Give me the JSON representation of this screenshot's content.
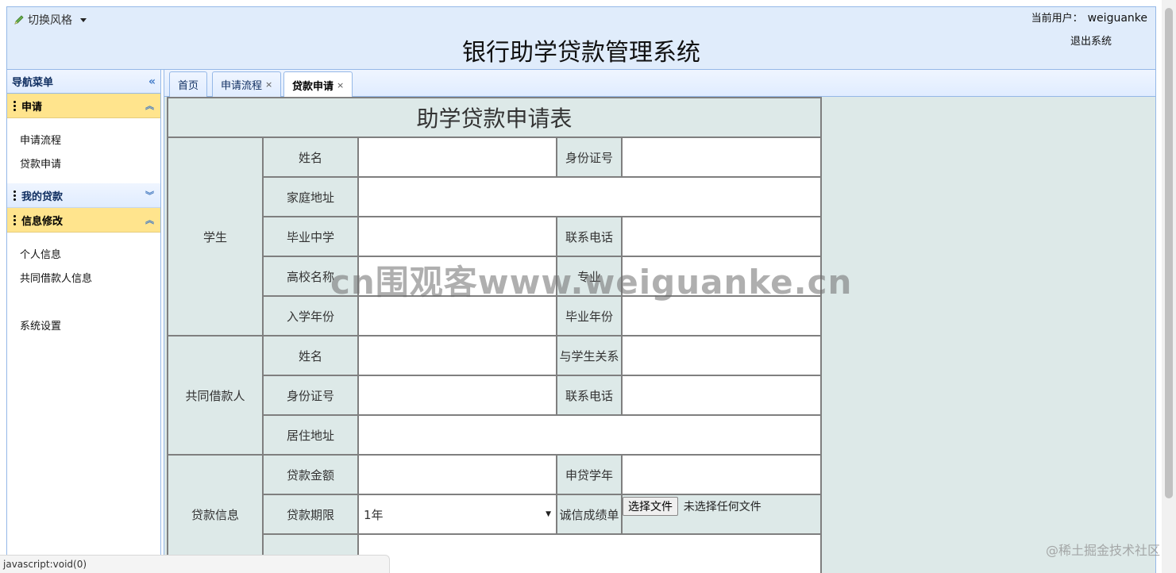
{
  "header": {
    "style_switch_label": "切换风格",
    "app_title": "银行助学贷款管理系统",
    "current_user_label": "当前用户：",
    "current_user_name": "weiguanke",
    "logout_label": "退出系统"
  },
  "sidebar": {
    "nav_title": "导航菜单",
    "sections": [
      {
        "title": "申请",
        "state": "open",
        "items": [
          "申请流程",
          "贷款申请"
        ]
      },
      {
        "title": "我的贷款",
        "state": "closed",
        "items": []
      },
      {
        "title": "信息修改",
        "state": "open",
        "items": [
          "个人信息",
          "共同借款人信息",
          "系统设置"
        ]
      }
    ]
  },
  "tabs": [
    {
      "label": "首页",
      "closable": false,
      "active": false
    },
    {
      "label": "申请流程",
      "closable": true,
      "active": false
    },
    {
      "label": "贷款申请",
      "closable": true,
      "active": true
    }
  ],
  "form": {
    "title": "助学贷款申请表",
    "groups": {
      "student": "学生",
      "co_borrower": "共同借款人",
      "loan_info": "贷款信息"
    },
    "fields": {
      "student_name": "姓名",
      "student_id": "身份证号",
      "home_address": "家庭地址",
      "high_school": "毕业中学",
      "student_phone": "联系电话",
      "college": "高校名称",
      "major": "专业",
      "enroll_year": "入学年份",
      "grad_year": "毕业年份",
      "co_name": "姓名",
      "relation": "与学生关系",
      "co_id": "身份证号",
      "co_phone": "联系电话",
      "residence": "居住地址",
      "loan_amount": "贷款金额",
      "loan_school_year": "申贷学年",
      "loan_term": "贷款期限",
      "credit_report": "诚信成绩单"
    },
    "loan_term_value": "1年",
    "file_button": "选择文件",
    "file_status": "未选择任何文件"
  },
  "watermark": "cn围观客www.weiguanke.cn",
  "corner_mark": "@稀土掘金技术社区",
  "status_bar": "javascript:void(0)",
  "colors": {
    "header_bg": "#e0ecfb",
    "accordion_open": "#ffe48d",
    "form_label_bg": "#dde9e8",
    "border": "#95b8e7"
  }
}
